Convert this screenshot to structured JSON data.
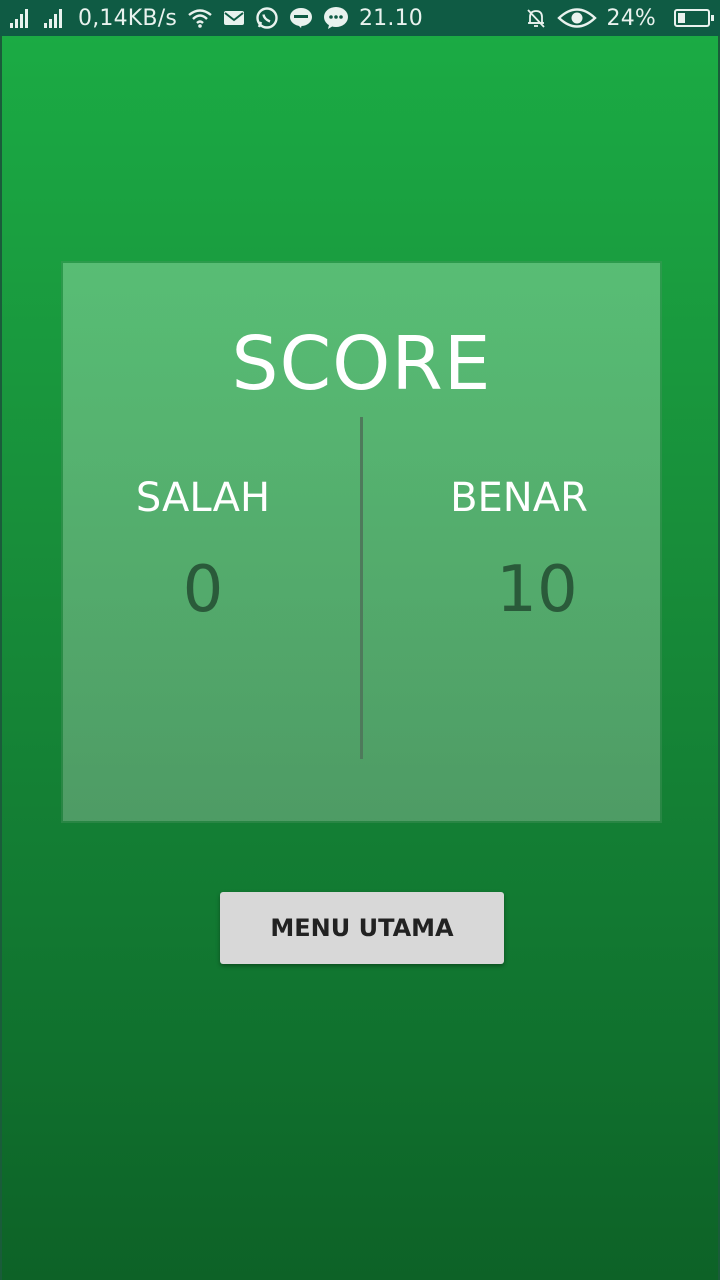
{
  "status_bar": {
    "speed": "0,14KB/s",
    "time": "21.10",
    "battery": "24%",
    "battery_level": 0.24,
    "icons": [
      "signal-icon",
      "signal-icon",
      "wifi-icon",
      "mail-icon",
      "whatsapp-icon",
      "line-icon",
      "chat-icon",
      "mute-icon",
      "eye-icon",
      "battery-icon"
    ]
  },
  "score": {
    "title": "SCORE",
    "wrong_label": "SALAH",
    "wrong_value": "0",
    "correct_label": "BENAR",
    "correct_value": "10"
  },
  "actions": {
    "menu_label": "MENU UTAMA"
  }
}
